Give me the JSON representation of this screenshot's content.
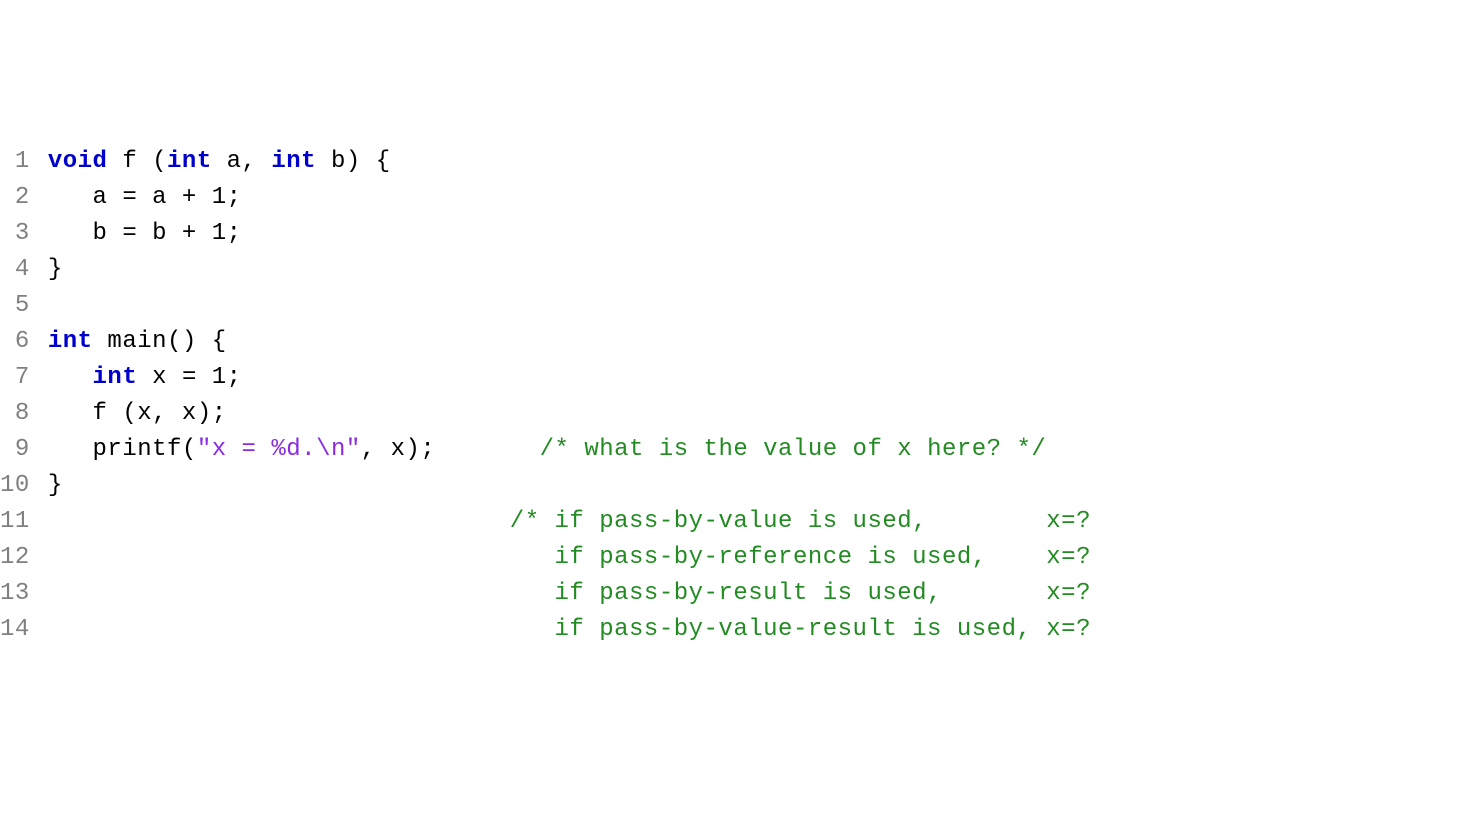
{
  "line_numbers": [
    "1",
    "2",
    "3",
    "4",
    "5",
    "6",
    "7",
    "8",
    "9",
    "10",
    "11",
    "12",
    "13",
    "14"
  ],
  "tokens": {
    "l1": {
      "kw_void": "void",
      "fname": " f (",
      "kw_int1": "int",
      "a_comma": " a, ",
      "kw_int2": "int",
      "b_brace": " b) {"
    },
    "l2": {
      "body": "   a = a + 1;"
    },
    "l3": {
      "body": "   b = b + 1;"
    },
    "l4": {
      "body": "}"
    },
    "l5": {
      "body": ""
    },
    "l6": {
      "kw_int": "int",
      "main": " main() {"
    },
    "l7": {
      "indent": "   ",
      "kw_int": "int",
      "rest": " x = 1;"
    },
    "l8": {
      "body": "   f (x, x);"
    },
    "l9": {
      "before": "   printf(",
      "string": "\"x = %d.\\n\"",
      "after": ", x);       ",
      "comment": "/* what is the value of x here? */"
    },
    "l10": {
      "body": "}"
    },
    "l11": {
      "pad": "                               ",
      "comment": "/* if pass-by-value is used,        x=?"
    },
    "l12": {
      "pad": "                                  ",
      "comment": "if pass-by-reference is used,    x=?"
    },
    "l13": {
      "pad": "                                  ",
      "comment": "if pass-by-result is used,       x=?"
    },
    "l14": {
      "pad": "                                  ",
      "comment": "if pass-by-value-result is used, x=?"
    }
  }
}
